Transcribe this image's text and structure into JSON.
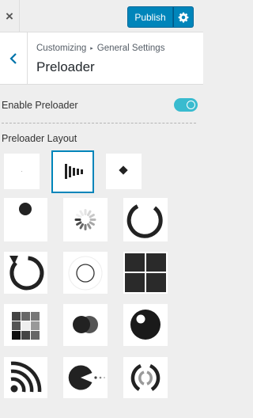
{
  "topbar": {
    "close_glyph": "×",
    "publish_label": "Publish",
    "settings_icon": "gear-icon"
  },
  "header": {
    "back_icon": "chevron-left-icon",
    "breadcrumb": [
      "Customizing",
      "General Settings"
    ],
    "breadcrumb_separator": "▸",
    "title": "Preloader"
  },
  "enable_preloader": {
    "label": "Enable Preloader",
    "enabled": true
  },
  "layout": {
    "label": "Preloader Layout",
    "selected": 2,
    "options": [
      {
        "id": 1,
        "name": "preloader-option-blank"
      },
      {
        "id": 2,
        "name": "preloader-option-bars"
      },
      {
        "id": 3,
        "name": "preloader-option-diamond"
      },
      {
        "id": 4,
        "name": "preloader-option-dot"
      },
      {
        "id": 5,
        "name": "preloader-option-dotted-spinner"
      },
      {
        "id": 6,
        "name": "preloader-option-ring-spinner"
      },
      {
        "id": 7,
        "name": "preloader-option-arrow-circle"
      },
      {
        "id": 8,
        "name": "preloader-option-double-ring"
      },
      {
        "id": 9,
        "name": "preloader-option-four-squares"
      },
      {
        "id": 10,
        "name": "preloader-option-grid-squares"
      },
      {
        "id": 11,
        "name": "preloader-option-overlapping-circles"
      },
      {
        "id": 12,
        "name": "preloader-option-eye-ball"
      },
      {
        "id": 13,
        "name": "preloader-option-rss-signal"
      },
      {
        "id": 14,
        "name": "preloader-option-pacman"
      },
      {
        "id": 15,
        "name": "preloader-option-bracket-arcs"
      }
    ]
  },
  "colors": {
    "accent": "#0085ba",
    "toggle_on": "#39bbcf",
    "icon_dark": "#222222"
  }
}
